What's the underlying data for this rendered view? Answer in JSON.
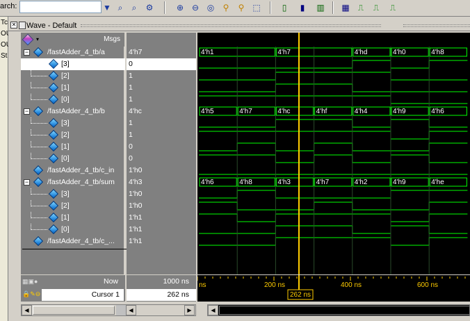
{
  "toolbar": {
    "search_label": "arch:",
    "search_value": ""
  },
  "left_strip": [
    "Tc",
    "OU",
    "OU",
    "St"
  ],
  "window": {
    "title": "Wave - Default"
  },
  "columns": {
    "msgs": "Msgs"
  },
  "signals": [
    {
      "name": "/fastAdder_4_tb/a",
      "value": "4'h7",
      "level": 0,
      "expanded": true
    },
    {
      "name": "[3]",
      "value": "0",
      "level": 1,
      "selected": true
    },
    {
      "name": "[2]",
      "value": "1",
      "level": 1
    },
    {
      "name": "[1]",
      "value": "1",
      "level": 1
    },
    {
      "name": "[0]",
      "value": "1",
      "level": 1
    },
    {
      "name": "/fastAdder_4_tb/b",
      "value": "4'hc",
      "level": 0,
      "expanded": true
    },
    {
      "name": "[3]",
      "value": "1",
      "level": 1
    },
    {
      "name": "[2]",
      "value": "1",
      "level": 1
    },
    {
      "name": "[1]",
      "value": "0",
      "level": 1
    },
    {
      "name": "[0]",
      "value": "0",
      "level": 1
    },
    {
      "name": "/fastAdder_4_tb/c_in",
      "value": "1'h0",
      "level": 0
    },
    {
      "name": "/fastAdder_4_tb/sum",
      "value": "4'h3",
      "level": 0,
      "expanded": true
    },
    {
      "name": "[3]",
      "value": "1'h0",
      "level": 1
    },
    {
      "name": "[2]",
      "value": "1'h0",
      "level": 1
    },
    {
      "name": "[1]",
      "value": "1'h1",
      "level": 1
    },
    {
      "name": "[0]",
      "value": "1'h1",
      "level": 1
    },
    {
      "name": "/fastAdder_4_tb/c_...",
      "value": "1'h1",
      "level": 0
    }
  ],
  "buses": {
    "a": [
      "4'h1",
      "4'h7",
      "4'hd",
      "4'h0",
      "4'h8"
    ],
    "b": [
      "4'h5",
      "4'h7",
      "4'hc",
      "4'hf",
      "4'h4",
      "4'h9",
      "4'h6"
    ],
    "sum": [
      "4'h6",
      "4'h8",
      "4'h3",
      "4'h7",
      "4'h2",
      "4'h9",
      "4'he"
    ]
  },
  "status": {
    "now_label": "Now",
    "now_value": "1000 ns",
    "cursor_label": "Cursor 1",
    "cursor_value": "262 ns",
    "cursor_flag": "262 ns"
  },
  "timeline": {
    "ticks": [
      "ns",
      "200 ns",
      "400 ns",
      "600 ns"
    ]
  },
  "colors": {
    "wave": "#00ff00",
    "cursor": "#ffcc00",
    "bg": "#000000",
    "panel": "#808080"
  }
}
